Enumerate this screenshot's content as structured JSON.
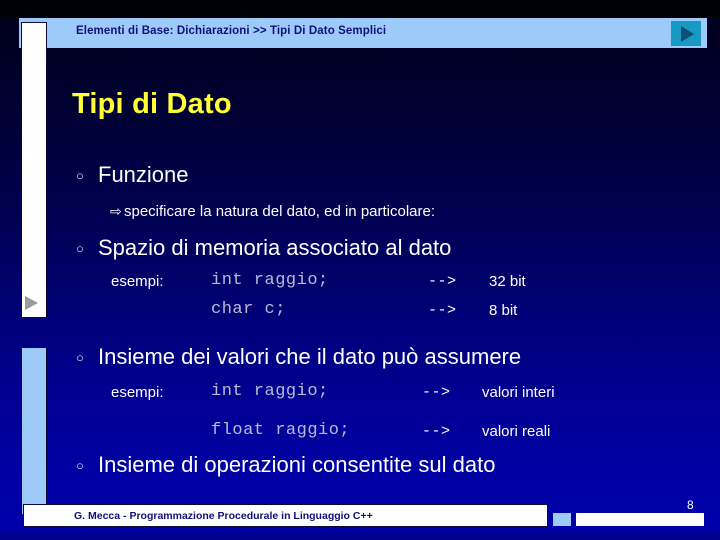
{
  "header": {
    "breadcrumb": "Elementi di Base: Dichiarazioni >> Tipi Di Dato Semplici",
    "next_button_icon": "play-triangle-icon"
  },
  "slide": {
    "title": "Tipi di Dato",
    "bullet_marker": "○",
    "sub_marker": "⇨",
    "bullets": [
      {
        "level": 1,
        "text": "Funzione"
      },
      {
        "level": 2,
        "text": "specificare la natura del dato, ed in particolare:"
      },
      {
        "level": 1,
        "text": "Spazio di memoria associato al dato"
      },
      {
        "level": 1,
        "text": "Insieme dei valori che il dato può assumere"
      },
      {
        "level": 1,
        "text": "Insieme di operazioni consentite sul dato"
      }
    ],
    "examples_1": {
      "label": "esempi:",
      "rows": [
        {
          "code": "int raggio;",
          "arrow": "-->",
          "value": "32 bit"
        },
        {
          "code": "char c;",
          "arrow": "-->",
          "value": "8 bit"
        }
      ]
    },
    "examples_2": {
      "label": "esempi:",
      "rows": [
        {
          "code": "int raggio;",
          "arrow": "-->",
          "value": "valori interi"
        },
        {
          "code": "float raggio;",
          "arrow": "-->",
          "value": "valori reali"
        }
      ]
    }
  },
  "footer": {
    "credit": "G. Mecca - Programmazione Procedurale in Linguaggio C++",
    "page_number": "8"
  },
  "colors": {
    "accent_light_blue": "#9ecaf9",
    "title_yellow": "#ffff33",
    "header_text_navy": "#10107a",
    "teal_button": "#1899c4",
    "code_text": "#b9bbd6",
    "body_text": "#ffffff"
  }
}
